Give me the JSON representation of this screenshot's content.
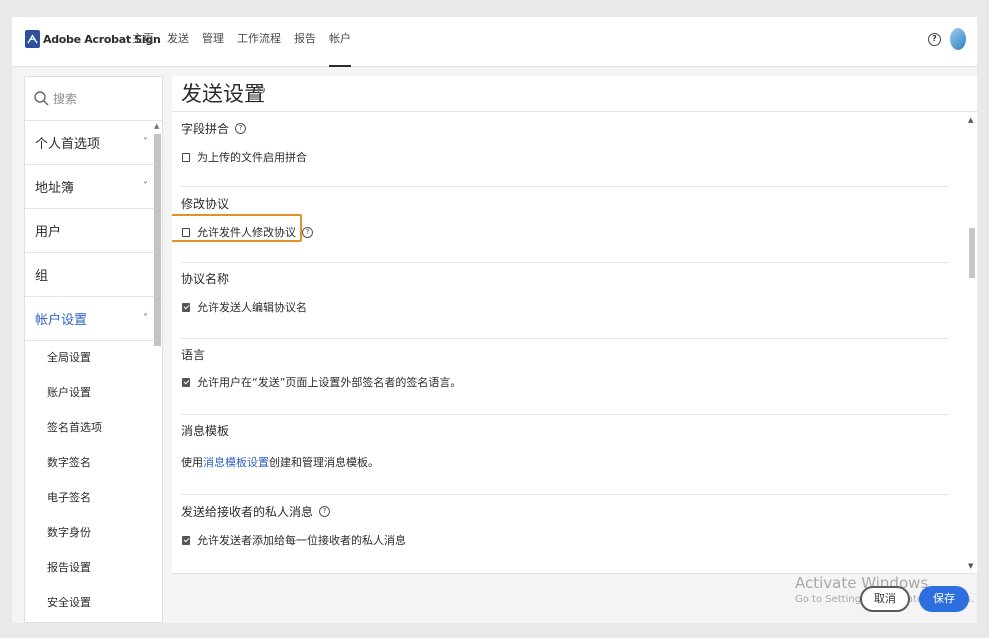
{
  "app": {
    "name": "Adobe Acrobat Sign"
  },
  "nav": [
    {
      "label": "主页"
    },
    {
      "label": "发送"
    },
    {
      "label": "管理"
    },
    {
      "label": "工作流程"
    },
    {
      "label": "报告"
    },
    {
      "label": "帐户",
      "active": true
    }
  ],
  "header": {
    "help": "?"
  },
  "sidebar": {
    "search_placeholder": "搜索",
    "items": [
      {
        "label": "个人首选项",
        "chevron": "˅"
      },
      {
        "label": "地址簿",
        "chevron": "˅"
      },
      {
        "label": "用户"
      },
      {
        "label": "组"
      },
      {
        "label": "帐户设置",
        "chevron": "˄",
        "expanded": true
      }
    ],
    "subitems": [
      "全局设置",
      "账户设置",
      "签名首选项",
      "数字签名",
      "电子签名",
      "数字身份",
      "报告设置",
      "安全设置"
    ]
  },
  "main": {
    "title": "发送设置",
    "sections": [
      {
        "title": "字段拼合",
        "option": "为上传的文件启用拼合",
        "checked": false
      },
      {
        "title": "修改协议",
        "option": "允许发件人修改协议",
        "checked": false
      },
      {
        "title": "协议名称",
        "option": "允许发送人编辑协议名",
        "checked": true
      },
      {
        "title": "语言",
        "option": "允许用户在“发送”页面上设置外部签名者的签名语言。",
        "checked": true
      },
      {
        "title": "消息模板",
        "text_pre": "使用",
        "link": "消息模板设置",
        "text_post": "创建和管理消息模板。"
      },
      {
        "title": "发送给接收者的私人消息",
        "option": "允许发送者添加给每一位接收者的私人消息",
        "checked": true
      }
    ]
  },
  "footer": {
    "cancel": "取消",
    "save": "保存"
  },
  "watermark": {
    "line1": "Activate Windows",
    "line2": "Go to Settings to activate Windows."
  },
  "colors": {
    "accent": "#2f63c4",
    "save_button": "#2d6fde",
    "highlight": "#e6902a"
  }
}
